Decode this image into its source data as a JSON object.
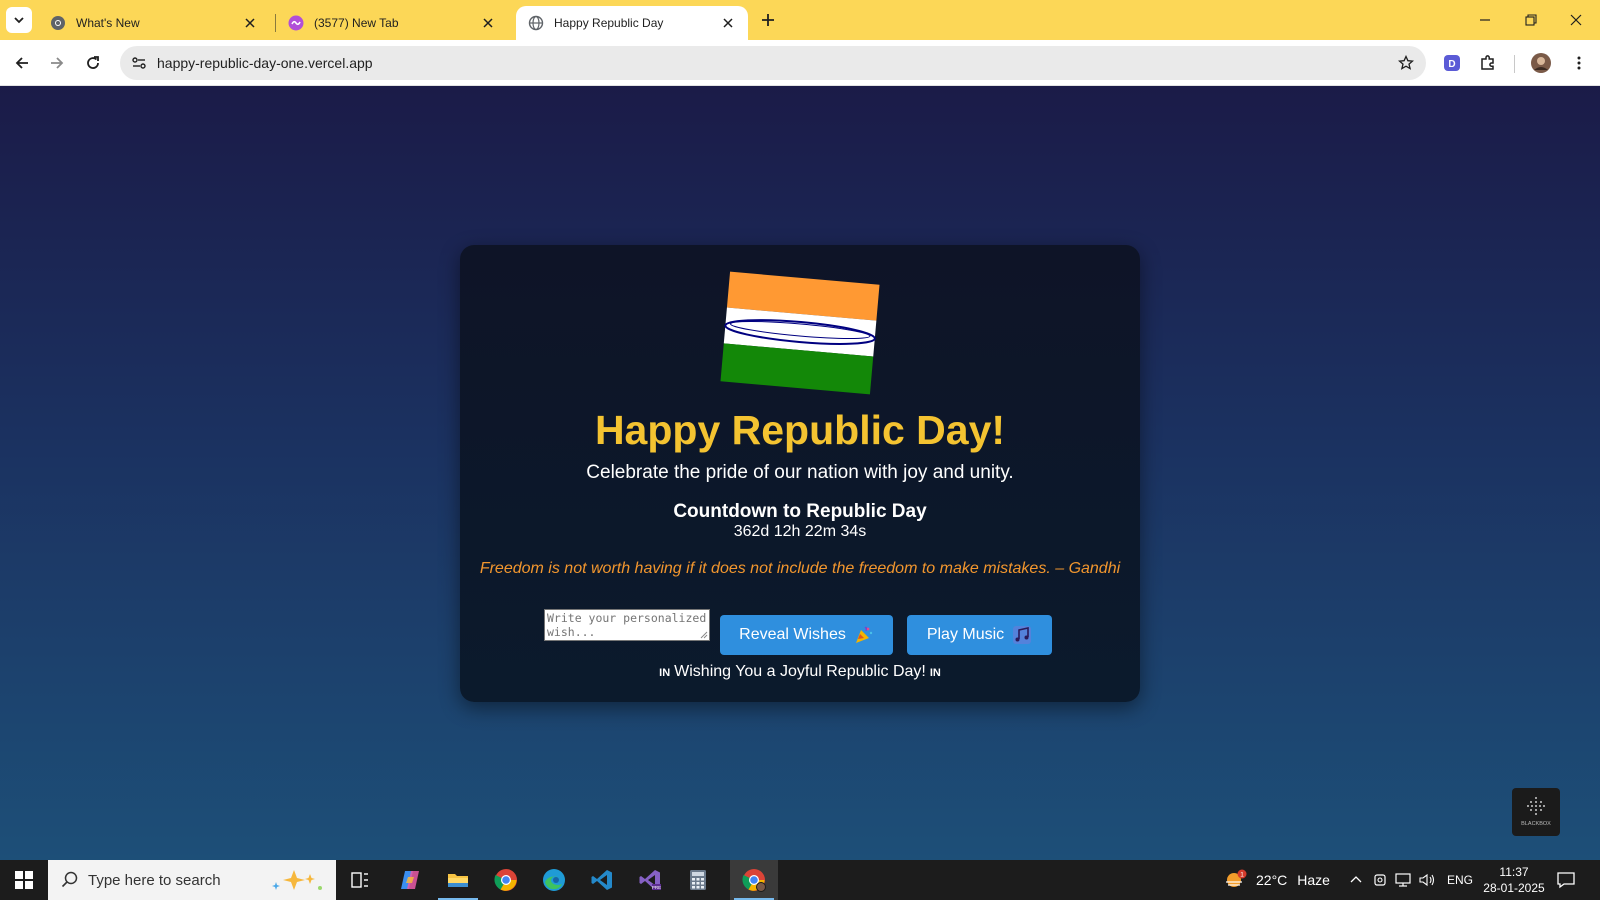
{
  "browser": {
    "tabs": [
      {
        "title": "What's New",
        "active": false
      },
      {
        "title": "(3577) New Tab",
        "active": false
      },
      {
        "title": "Happy Republic Day",
        "active": true
      }
    ],
    "url": "happy-republic-day-one.vercel.app",
    "accent_color": "#fcd757"
  },
  "page": {
    "heading": "Happy Republic Day!",
    "subtitle": "Celebrate the pride of our nation with joy and unity.",
    "countdown_title": "Countdown to Republic Day",
    "countdown_value": "362d 12h 22m 34s",
    "quote": "Freedom is not worth having if it does not include the freedom to make mistakes. – Gandhi",
    "wish_placeholder": "Write your personalized wish...",
    "reveal_button": "Reveal Wishes",
    "music_button": "Play Music",
    "footer_prefix": "IN",
    "footer_text": "Wishing You a Joyful Republic Day!",
    "footer_suffix": "IN",
    "colors": {
      "heading": "#f4c331",
      "quote": "#f2962e",
      "button": "#2f8fde",
      "saffron": "#ff9933",
      "green": "#138808",
      "chakra": "#000080"
    }
  },
  "overlay_badge": "BLACKBOX",
  "taskbar": {
    "search_placeholder": "Type here to search",
    "apps": [
      "task-view-icon",
      "copilot-icon",
      "file-explorer-icon",
      "chrome-icon",
      "edge-icon",
      "vscode-icon",
      "visual-studio-icon",
      "calculator-icon",
      "chrome-profile-icon"
    ],
    "weather": {
      "temp": "22°C",
      "condition": "Haze",
      "badge": "1"
    },
    "language": "ENG",
    "time": "11:37",
    "date": "28-01-2025"
  }
}
